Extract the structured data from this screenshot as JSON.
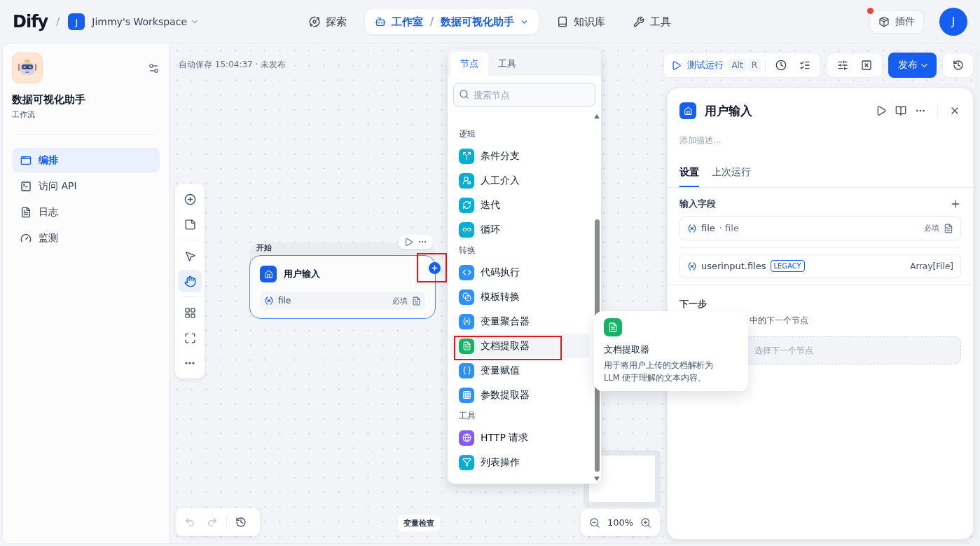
{
  "header": {
    "logo": "Dify",
    "separator": "/",
    "workspace": {
      "initial": "J",
      "name": "Jimmy's Workspace"
    },
    "nav": [
      {
        "label": "探索",
        "kind": "explore",
        "selected": false
      },
      {
        "label": "工作室",
        "kind": "studio",
        "selected": true,
        "separator": "/",
        "app": "数据可视化助手"
      },
      {
        "label": "知识库",
        "kind": "knowledge",
        "selected": false
      },
      {
        "label": "工具",
        "kind": "tools",
        "selected": false
      }
    ],
    "plugins": {
      "label": "插件",
      "notification": true
    },
    "avatar": "J"
  },
  "sidebar": {
    "app_name": "数据可视化助手",
    "app_type": "工作流",
    "items": [
      {
        "label": "编排",
        "kind": "orchestrate",
        "selected": true
      },
      {
        "label": "访问 API",
        "kind": "api",
        "selected": false
      },
      {
        "label": "日志",
        "kind": "logs",
        "selected": false
      },
      {
        "label": "监测",
        "kind": "monitor",
        "selected": false
      }
    ]
  },
  "canvas": {
    "autosave": "自动保存 15:04:37 · 未发布",
    "tools": [
      {
        "kind": "add"
      },
      {
        "kind": "note"
      },
      {
        "kind": "divider"
      },
      {
        "kind": "pointer",
        "selected": false
      },
      {
        "kind": "hand",
        "selected": true
      },
      {
        "kind": "divider"
      },
      {
        "kind": "organize"
      },
      {
        "kind": "fit"
      },
      {
        "kind": "more"
      }
    ],
    "node": {
      "header": "开始",
      "title": "用户输入",
      "handle_highlighted": true,
      "fields": [
        {
          "name": "file",
          "required": "必填"
        }
      ]
    },
    "variable_inspect": "变量检查",
    "zoom": "100%"
  },
  "node_picker": {
    "tabs": [
      {
        "label": "节点",
        "selected": true
      },
      {
        "label": "工具",
        "selected": false
      }
    ],
    "search_placeholder": "搜索节点",
    "groups": [
      {
        "title": "逻辑",
        "items": [
          {
            "label": "条件分支",
            "kind": "branch",
            "color": "#06aed4",
            "hovered": false,
            "highlighted": false
          },
          {
            "label": "人工介入",
            "kind": "human",
            "color": "#06aed4",
            "hovered": false,
            "highlighted": false
          },
          {
            "label": "迭代",
            "kind": "iteration",
            "color": "#06aed4",
            "hovered": false,
            "highlighted": false
          },
          {
            "label": "循环",
            "kind": "loop",
            "color": "#06aed4",
            "hovered": false,
            "highlighted": false
          }
        ]
      },
      {
        "title": "转换",
        "items": [
          {
            "label": "代码执行",
            "kind": "code",
            "color": "#2e90fa",
            "hovered": false,
            "highlighted": false
          },
          {
            "label": "模板转换",
            "kind": "template",
            "color": "#2e90fa",
            "hovered": false,
            "highlighted": false
          },
          {
            "label": "变量聚合器",
            "kind": "aggregator",
            "color": "#2e90fa",
            "hovered": false,
            "highlighted": false
          },
          {
            "label": "文档提取器",
            "kind": "extractor",
            "color": "#16b364",
            "hovered": true,
            "highlighted": true
          },
          {
            "label": "变量赋值",
            "kind": "assigner",
            "color": "#2e90fa",
            "hovered": false,
            "highlighted": false
          },
          {
            "label": "参数提取器",
            "kind": "parameter",
            "color": "#2e90fa",
            "hovered": false,
            "highlighted": false
          }
        ]
      },
      {
        "title": "工具",
        "items": [
          {
            "label": "HTTP 请求",
            "kind": "http",
            "color": "#875bf7",
            "hovered": false,
            "highlighted": false
          },
          {
            "label": "列表操作",
            "kind": "list",
            "color": "#06aed4",
            "hovered": false,
            "highlighted": false
          }
        ]
      }
    ],
    "tooltip": {
      "title": "文档提取器",
      "description": "用于将用户上传的文档解析为 LLM 便于理解的文本内容。"
    }
  },
  "toolbar": {
    "run": "测试运行",
    "keys": [
      "Alt",
      "R"
    ],
    "publish": "发布"
  },
  "panel": {
    "title": "用户输入",
    "description_placeholder": "添加描述...",
    "tabs": [
      {
        "label": "设置",
        "selected": true
      },
      {
        "label": "上次运行",
        "selected": false
      }
    ],
    "input_title": "输入字段",
    "fields": [
      {
        "name": "file",
        "label": "· file",
        "required": "必填"
      }
    ],
    "legacy": {
      "name": "userinput.files",
      "badge": "LEGACY",
      "type": "Array[File]"
    },
    "next_title": "下一步",
    "next_description": "中的下一个节点",
    "next_placeholder": "选择下一个节点"
  }
}
